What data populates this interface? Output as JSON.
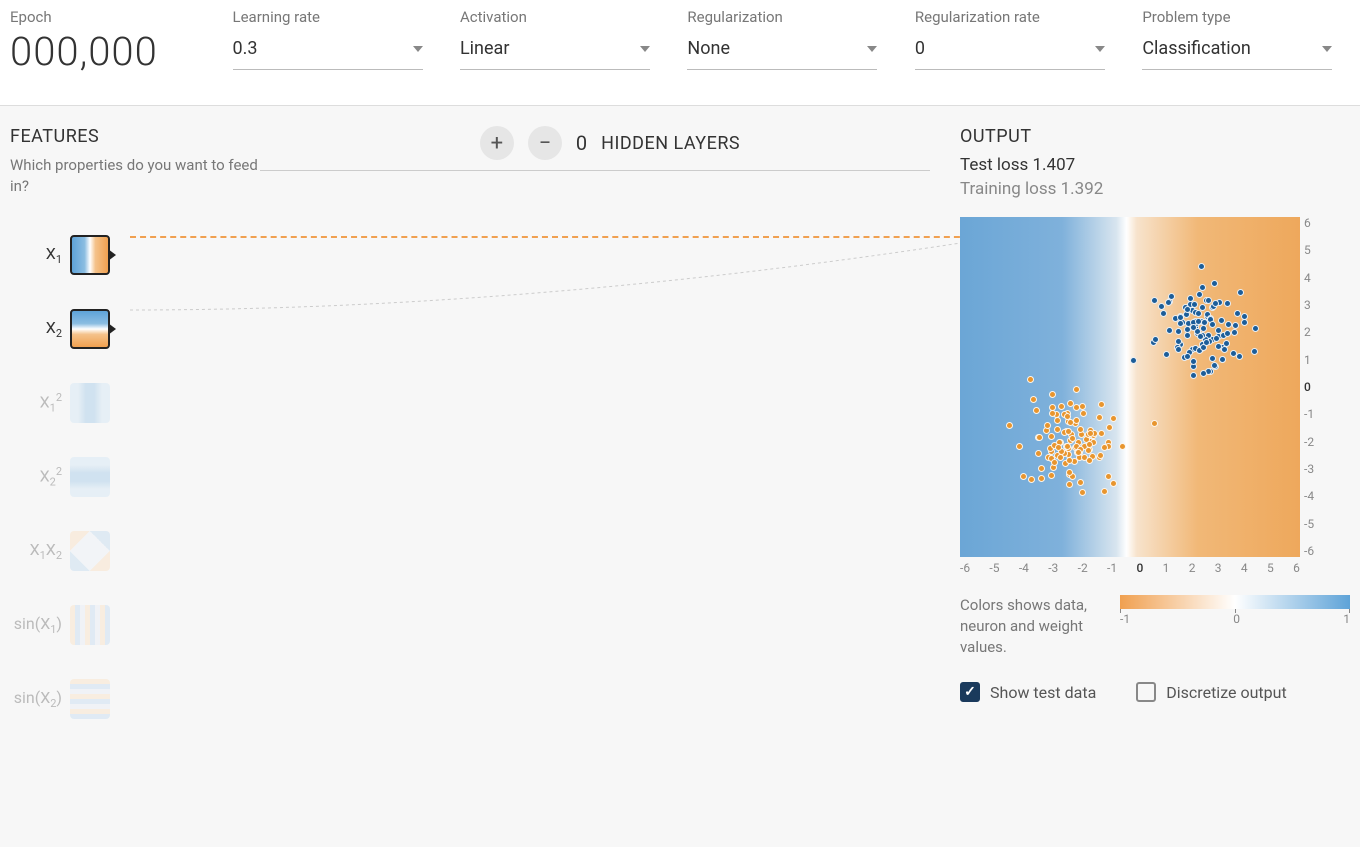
{
  "header": {
    "epoch": {
      "label": "Epoch",
      "value": "000,000"
    },
    "learning_rate": {
      "label": "Learning rate",
      "value": "0.3"
    },
    "activation": {
      "label": "Activation",
      "value": "Linear"
    },
    "regularization": {
      "label": "Regularization",
      "value": "None"
    },
    "regularization_rate": {
      "label": "Regularization rate",
      "value": "0"
    },
    "problem_type": {
      "label": "Problem type",
      "value": "Classification"
    }
  },
  "features": {
    "title": "FEATURES",
    "subtitle": "Which properties do you want to feed in?",
    "items": [
      "X₁",
      "X₂",
      "X₁²",
      "X₂²",
      "X₁X₂",
      "sin(X₁)",
      "sin(X₂)"
    ]
  },
  "hidden": {
    "count": "0",
    "label": "HIDDEN LAYERS"
  },
  "output": {
    "title": "OUTPUT",
    "test_loss_label": "Test loss",
    "test_loss": "1.407",
    "training_loss_label": "Training loss",
    "training_loss": "1.392",
    "axis_y": [
      "6",
      "5",
      "4",
      "3",
      "2",
      "1",
      "0",
      "-1",
      "-2",
      "-3",
      "-4",
      "-5",
      "-6"
    ],
    "axis_x": [
      "-6",
      "-5",
      "-4",
      "-3",
      "-2",
      "-1",
      "0",
      "1",
      "2",
      "3",
      "4",
      "5",
      "6"
    ],
    "legend_text": "Colors shows data, neuron and weight values.",
    "legend_ticks": [
      "-1",
      "0",
      "1"
    ],
    "show_test_data": "Show test data",
    "discretize_output": "Discretize output"
  },
  "chart_data": {
    "type": "scatter",
    "xlim": [
      -6,
      6
    ],
    "ylim": [
      -6,
      6
    ],
    "series": [
      {
        "name": "orange",
        "color": "#e8952e",
        "cluster_center": [
          -2,
          -2
        ],
        "cluster_spread": 1.5,
        "n_points": 110
      },
      {
        "name": "blue",
        "color": "#1c5d99",
        "cluster_center": [
          2.5,
          2
        ],
        "cluster_spread": 1.4,
        "n_points": 110
      }
    ],
    "background_gradient": "horizontal blue-to-orange decision boundary near x=0"
  }
}
